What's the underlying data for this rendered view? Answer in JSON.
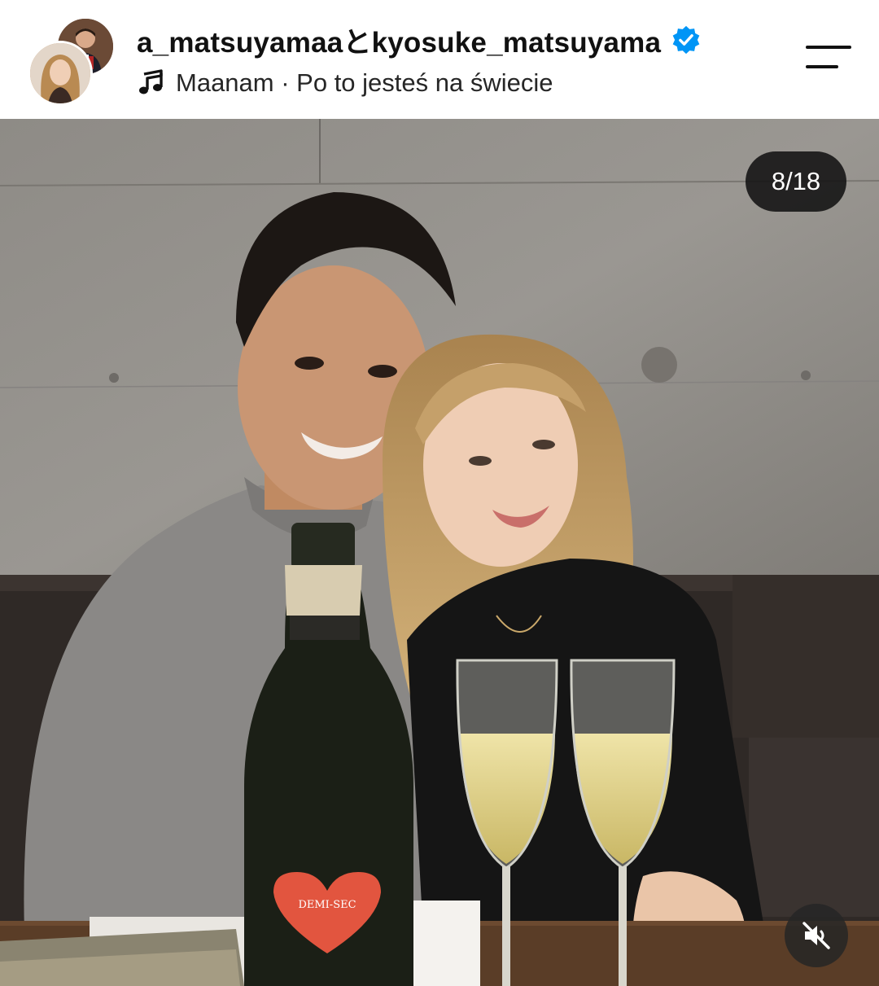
{
  "header": {
    "title": "a_matsuyamaaとkyosuke_matsuyama",
    "verified_icon": "verified-badge-icon",
    "music": {
      "icon": "music-note-icon",
      "text": "Maanam · Po to jesteś na świecie"
    },
    "menu_icon": "hamburger-menu-icon"
  },
  "post": {
    "counter": "8/18",
    "mute_icon": "speaker-muted-icon",
    "bottle_label": "DEMI-SEC"
  },
  "colors": {
    "verified": "#0095f6",
    "text": "#111111",
    "counter_bg": "#121212"
  }
}
